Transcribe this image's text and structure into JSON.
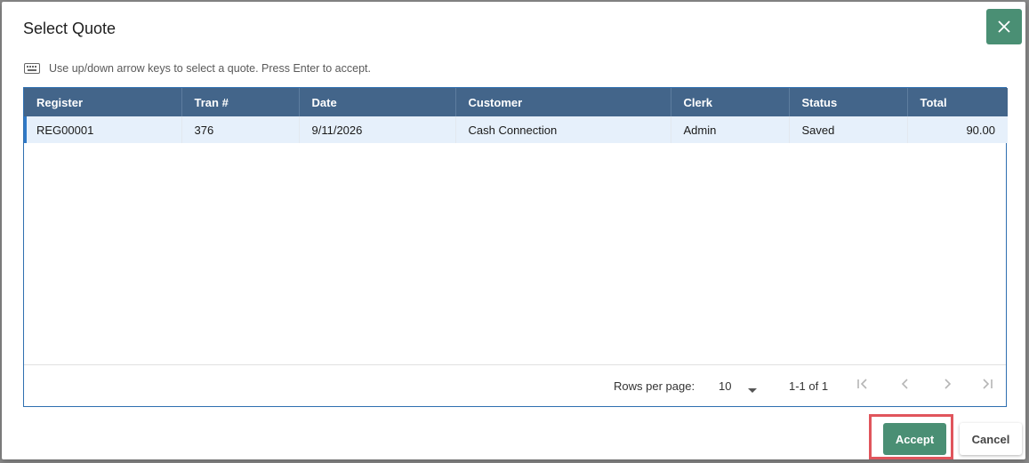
{
  "dialog": {
    "title": "Select Quote",
    "hint": "Use up/down arrow keys to select a quote. Press Enter to accept.",
    "close_icon": "close-icon",
    "keyboard_icon": "keyboard-icon"
  },
  "table": {
    "columns": [
      "Register",
      "Tran #",
      "Date",
      "Customer",
      "Clerk",
      "Status",
      "Total"
    ],
    "rows": [
      [
        "REG00001",
        "376",
        "9/11/2026",
        "Cash Connection",
        "Admin",
        "Saved",
        "90.00"
      ]
    ]
  },
  "pager": {
    "rows_per_page_label": "Rows per page:",
    "rows_per_page_value": "10",
    "range": "1-1 of 1"
  },
  "footer": {
    "accept_label": "Accept",
    "cancel_label": "Cancel"
  },
  "colors": {
    "primary": "#4a8f74",
    "header": "#43658a",
    "selected_row": "#e6f0fb",
    "highlight": "#e0555c"
  }
}
